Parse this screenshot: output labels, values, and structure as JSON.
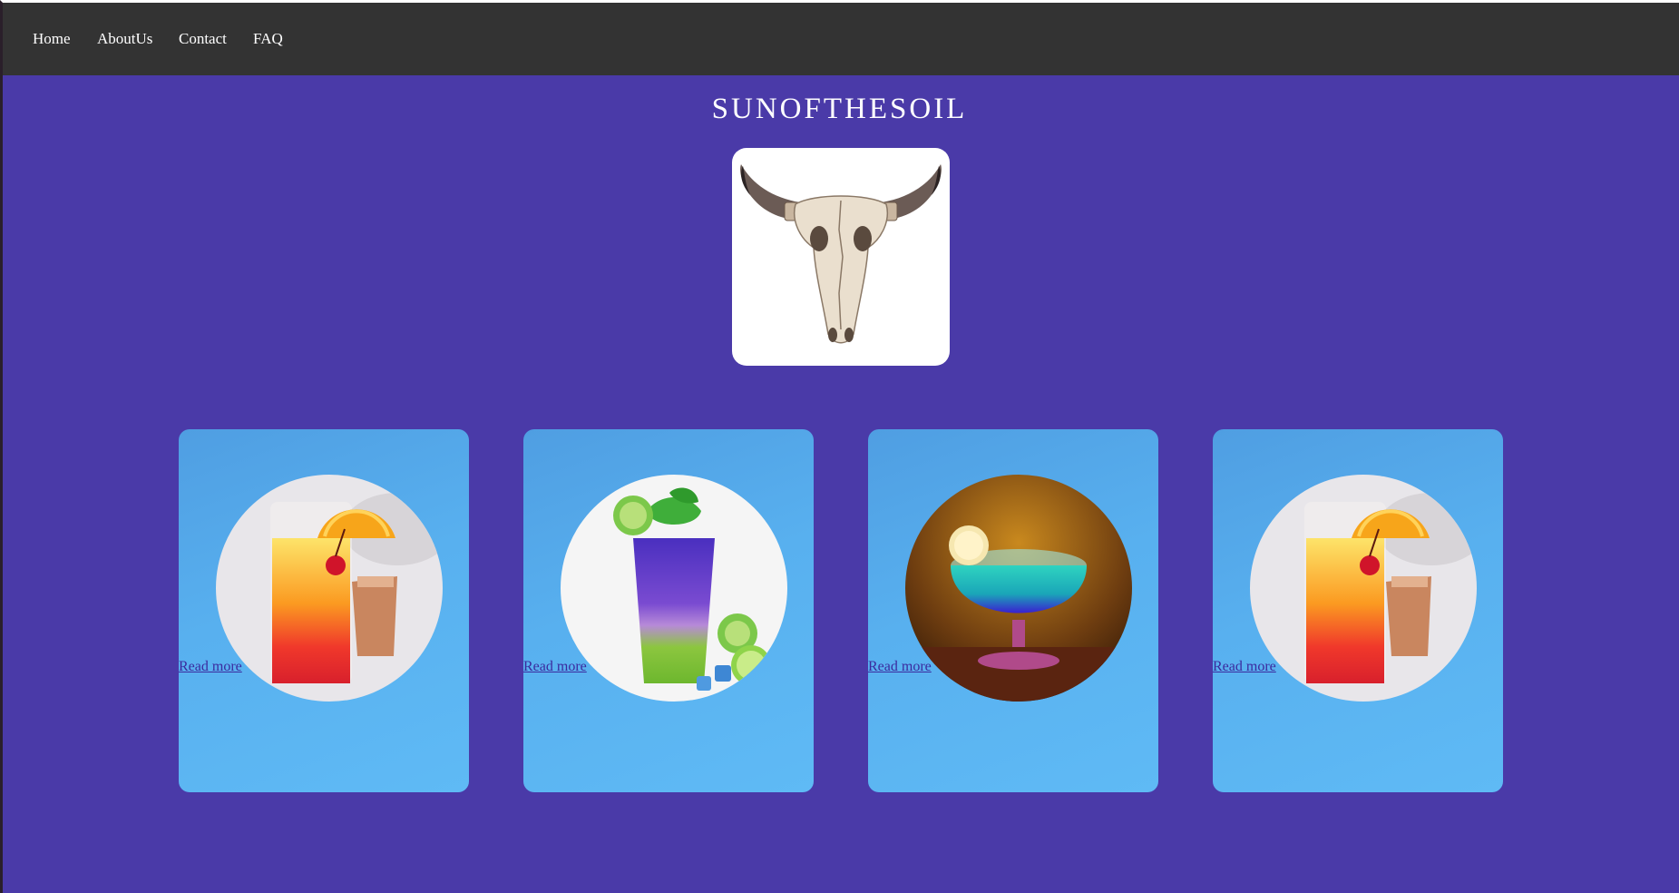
{
  "nav": {
    "items": [
      {
        "label": "Home"
      },
      {
        "label": "AboutUs"
      },
      {
        "label": "Contact"
      },
      {
        "label": "FAQ"
      }
    ]
  },
  "header": {
    "title": "SUNOFTHESOIL",
    "logo_icon": "bull-skull-icon"
  },
  "cards": [
    {
      "link_label": "Read more",
      "image": "tequila-sunrise-cocktail"
    },
    {
      "link_label": "Read more",
      "image": "layered-kiwi-mojito-cocktail"
    },
    {
      "link_label": "Read more",
      "image": "blue-lagoon-snifter-cocktail"
    },
    {
      "link_label": "Read more",
      "image": "tequila-sunrise-cocktail"
    }
  ],
  "colors": {
    "page_bg": "#4a3aa8",
    "nav_bg": "#333333",
    "card_bg": "#58b0ef",
    "link": "#3b2a9e"
  }
}
